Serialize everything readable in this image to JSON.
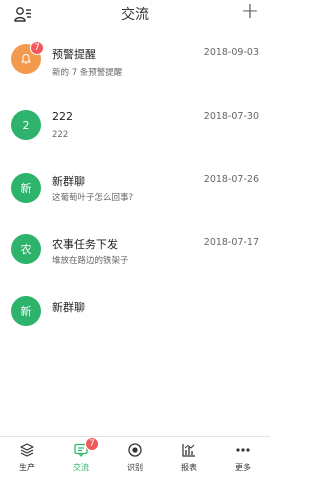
{
  "header": {
    "title": "交流",
    "left_icon": "contacts-icon",
    "right_icon": "plus-icon"
  },
  "colors": {
    "accent": "#2db36b",
    "alert": "#f39a4f",
    "badge": "#f0585a"
  },
  "conversations": [
    {
      "avatar_text": "",
      "avatar_icon": "bell-icon",
      "avatar_color": "#f39a4f",
      "badge": "7",
      "title": "预警提醒",
      "date": "2018-09-03",
      "preview": "新的 7 条预警提醒"
    },
    {
      "avatar_text": "2",
      "avatar_color": "#2db36b",
      "badge": "",
      "title": "222",
      "date": "2018-07-30",
      "preview": "222"
    },
    {
      "avatar_text": "新",
      "avatar_color": "#2db36b",
      "badge": "",
      "title": "新群聊",
      "date": "2018-07-26",
      "preview": "这葡萄叶子怎么回事?"
    },
    {
      "avatar_text": "农",
      "avatar_color": "#2db36b",
      "badge": "",
      "title": "农事任务下发",
      "date": "2018-07-17",
      "preview": "堆放在路边的铁架子"
    },
    {
      "avatar_text": "新",
      "avatar_color": "#2db36b",
      "badge": "",
      "title": "新群聊",
      "date": "",
      "preview": ""
    }
  ],
  "tabs": [
    {
      "label": "生产",
      "icon": "layers-icon",
      "active": false,
      "badge": ""
    },
    {
      "label": "交流",
      "icon": "chat-icon",
      "active": true,
      "badge": "7"
    },
    {
      "label": "识别",
      "icon": "scan-icon",
      "active": false,
      "badge": ""
    },
    {
      "label": "报表",
      "icon": "chart-icon",
      "active": false,
      "badge": ""
    },
    {
      "label": "更多",
      "icon": "more-icon",
      "active": false,
      "badge": ""
    }
  ]
}
